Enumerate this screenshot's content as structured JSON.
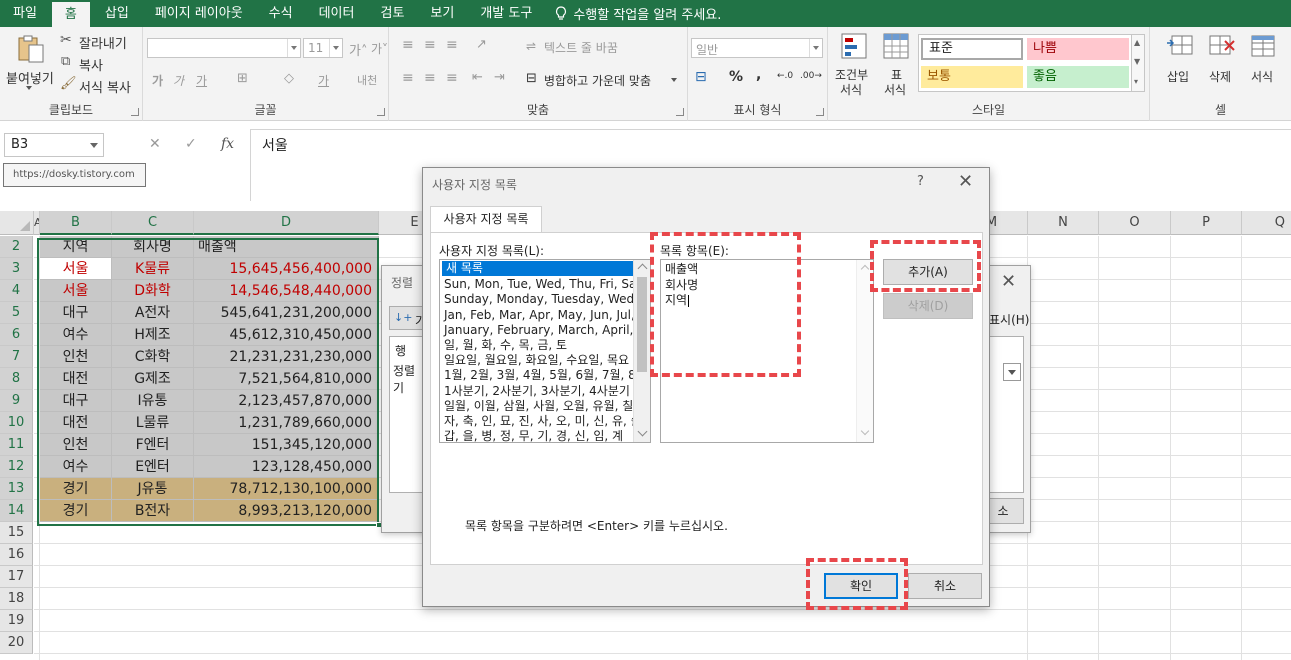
{
  "tabs": [
    "파일",
    "홈",
    "삽입",
    "페이지 레이아웃",
    "수식",
    "데이터",
    "검토",
    "보기",
    "개발 도구"
  ],
  "active_tab": "홈",
  "tell_me": "수행할 작업을 알려 주세요.",
  "ribbon": {
    "clipboard": {
      "paste": "붙여넣기",
      "cut": "잘라내기",
      "copy": "복사",
      "format_painter": "서식 복사",
      "label": "클립보드"
    },
    "font": {
      "size": "11",
      "label": "글꼴"
    },
    "align": {
      "wrap": "텍스트 줄 바꿈",
      "merge": "병합하고 가운데 맞춤",
      "label": "맞춤"
    },
    "number": {
      "format": "일반",
      "label": "표시 형식"
    },
    "styles": {
      "conditional": [
        "조건부",
        "서식"
      ],
      "table": [
        "표",
        "서식"
      ],
      "normal": "표준",
      "bad": "나쁨",
      "neutral": "보통",
      "good": "좋음",
      "label": "스타일"
    },
    "cells": {
      "insert": "삽입",
      "delete": "삭제",
      "format": "서식",
      "label": "셀"
    }
  },
  "formula_bar": {
    "name_box": "B3",
    "value": "서울",
    "tooltip_url": "https://dosky.tistory.com"
  },
  "columns_left": [
    "A",
    "B",
    "C",
    "D",
    "E"
  ],
  "columns_right": [
    "M",
    "N",
    "O",
    "P",
    "Q"
  ],
  "rows": [
    "2",
    "3",
    "4",
    "5",
    "6",
    "7",
    "8",
    "9",
    "10",
    "11",
    "12",
    "13",
    "14",
    "15",
    "16",
    "17",
    "18",
    "19",
    "20"
  ],
  "table": {
    "headers": [
      "지역",
      "회사명",
      "매출액"
    ],
    "data": [
      [
        "서울",
        "K물류",
        "15,645,456,400,000"
      ],
      [
        "서울",
        "D화학",
        "14,546,548,440,000"
      ],
      [
        "대구",
        "A전자",
        "545,641,231,200,000"
      ],
      [
        "여수",
        "H제조",
        "45,612,310,450,000"
      ],
      [
        "인천",
        "C화학",
        "21,231,231,230,000"
      ],
      [
        "대전",
        "G제조",
        "7,521,564,810,000"
      ],
      [
        "대구",
        "I유통",
        "2,123,457,870,000"
      ],
      [
        "대전",
        "L물류",
        "1,231,789,660,000"
      ],
      [
        "인천",
        "F엔터",
        "151,345,120,000"
      ],
      [
        "여수",
        "E엔터",
        "123,128,450,000"
      ],
      [
        "경기",
        "J유통",
        "78,712,130,100,000"
      ],
      [
        "경기",
        "B전자",
        "8,993,213,120,000"
      ]
    ]
  },
  "colors": {
    "excel_green": "#217346",
    "header_fill": "#c8c8c8",
    "gold_fill": "#c9b07e",
    "red_text": "#c00000",
    "highlight": "#e8474b"
  },
  "sort_dialog": {
    "title": "정렬",
    "add_level": "기",
    "row_label": "행",
    "sort_label": "정렬 기",
    "show": "표시(H)",
    "cancel": "소"
  },
  "custom_list_dialog": {
    "title": "사용자 지정 목록",
    "tab": "사용자 지정 목록",
    "lists_label": "사용자 지정 목록(L):",
    "entries_label": "목록 항목(E):",
    "lists": [
      "새 목록",
      "Sun, Mon, Tue, Wed, Thu, Fri, Sat",
      "Sunday, Monday, Tuesday, Wednes",
      "Jan, Feb, Mar, Apr, May, Jun, Jul, A",
      "January, February, March, April, Ma",
      "일, 월, 화, 수, 목, 금, 토",
      "일요일, 월요일, 화요일, 수요일, 목요",
      "1월, 2월, 3월, 4월, 5월, 6월, 7월, 8",
      "1사분기, 2사분기, 3사분기, 4사분기",
      "일월, 이월, 삼월, 사월, 오월, 유월, 칠",
      "자, 축, 인, 묘, 진, 사, 오, 미, 신, 유, 술",
      "갑, 을, 병, 정, 무, 기, 경, 신, 임, 계"
    ],
    "entries": [
      "매출액",
      "회사명",
      "지역"
    ],
    "add_button": "추가(A)",
    "delete_button": "삭제(D)",
    "hint": "목록 항목을 구분하려면 <Enter> 키를 누르십시오.",
    "ok_button": "확인",
    "cancel_button": "취소"
  }
}
